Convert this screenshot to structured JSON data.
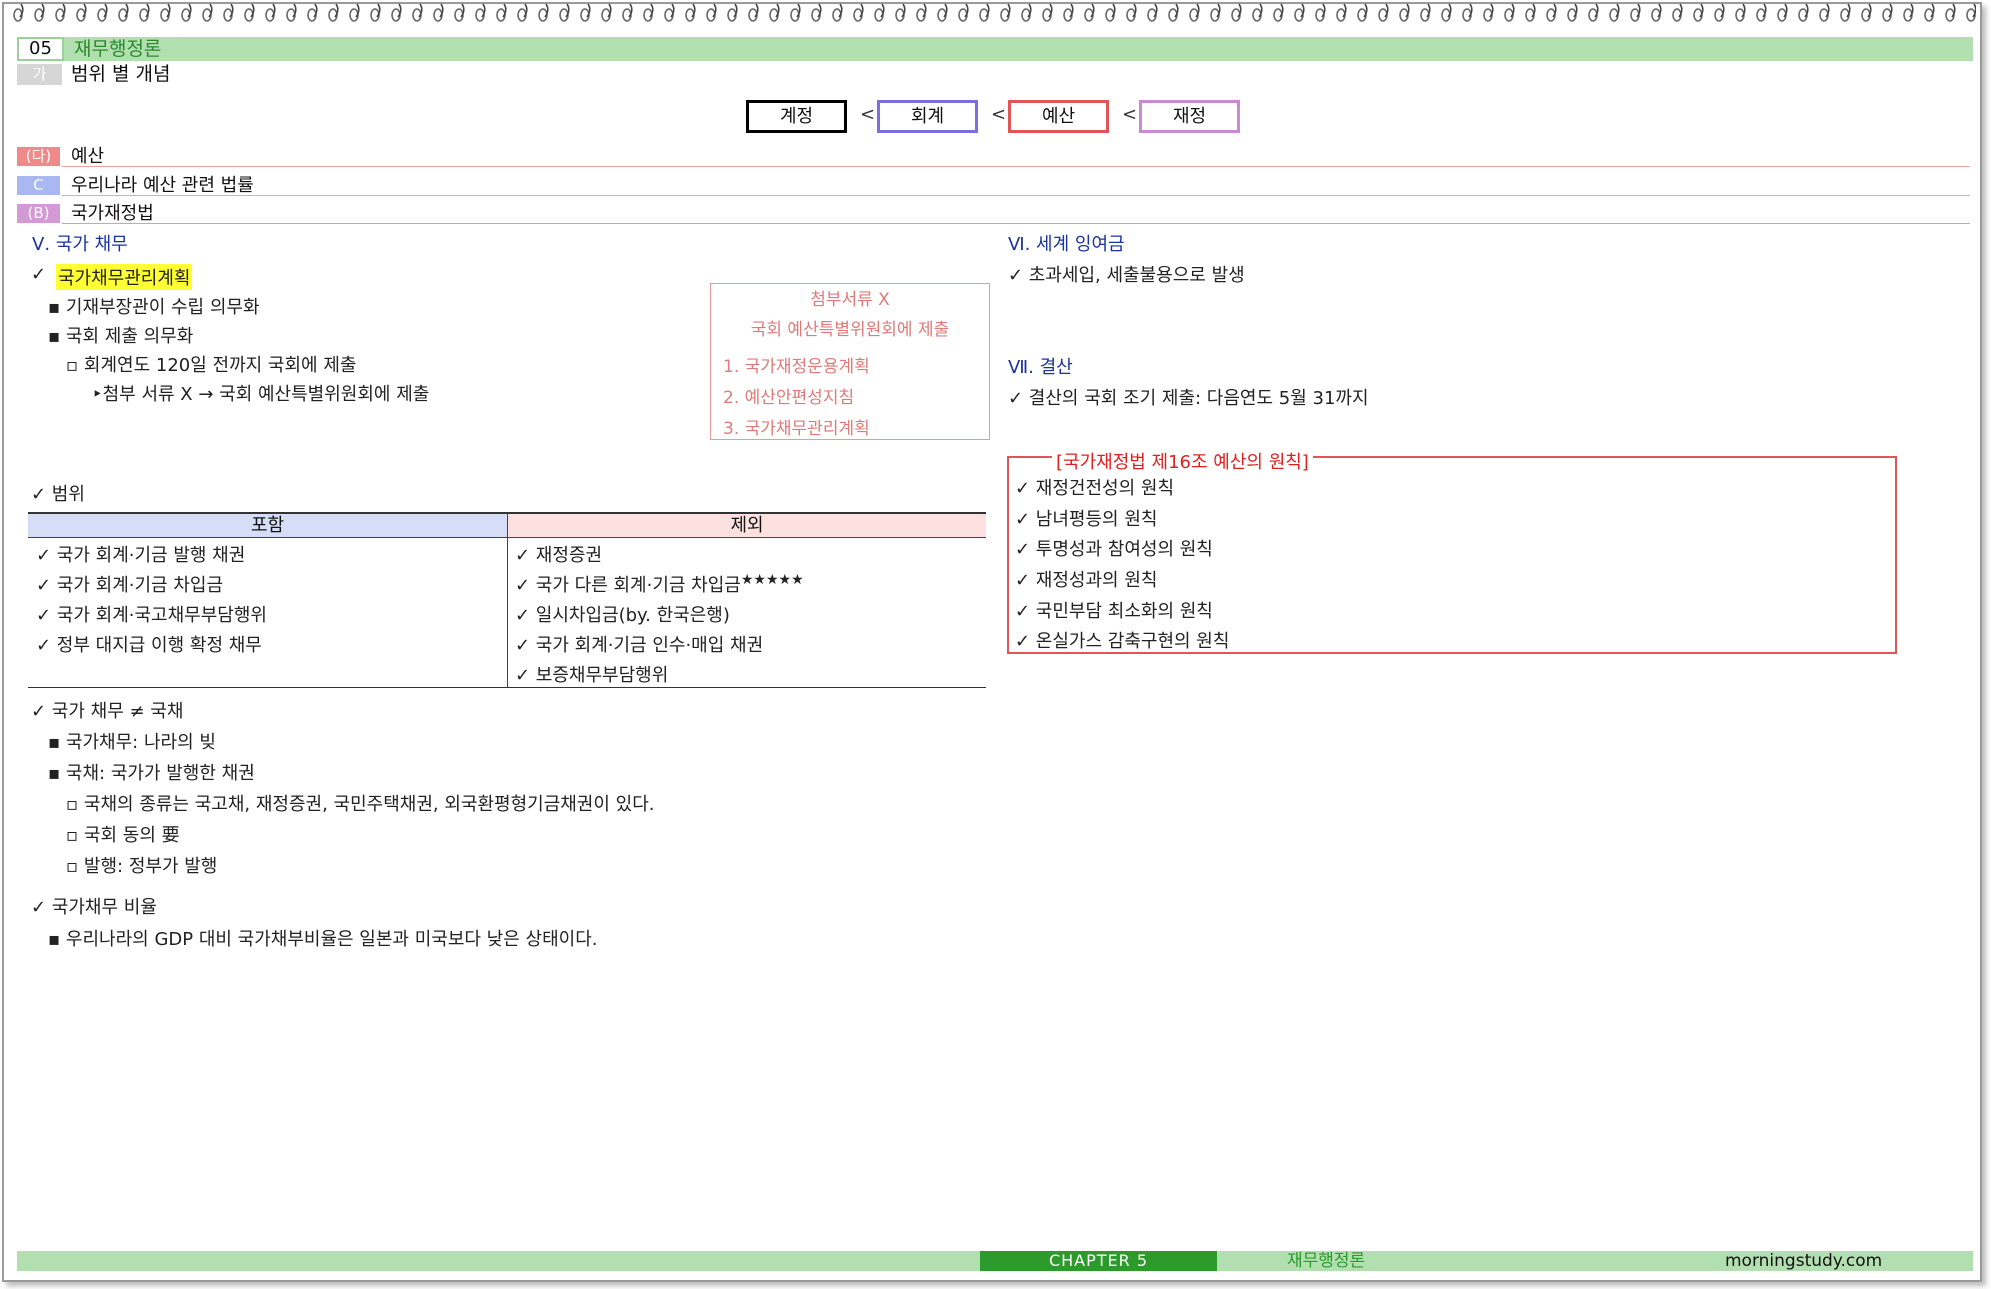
{
  "header": {
    "number": "05",
    "title": "재무행정론",
    "subtitle_tag": "가",
    "subtitle": "범위 별 개념"
  },
  "scope_chain": {
    "items": [
      "계정",
      "회계",
      "예산",
      "재정"
    ],
    "separator": "<",
    "colors": [
      "#000000",
      "#7b6fe0",
      "#e05555",
      "#c88ad0"
    ]
  },
  "sections": [
    {
      "tag": "(다)",
      "label": "예산",
      "color": "#f08a8a"
    },
    {
      "tag": "C",
      "label": "우리나라 예산 관련 법률",
      "color": "#a9b8f0"
    },
    {
      "tag": "(B)",
      "label": "국가재정법",
      "color": "#d39ad6"
    }
  ],
  "left": {
    "heading": "Ⅴ. 국가 채무",
    "plan": {
      "check_title": "✓",
      "title": "국가채무관리계획",
      "items": [
        "▪ 기재부장관이 수립 의무화",
        "▪ 국회 제출 의무화",
        "▫ 회계연도 120일 전까지 국회에 제출",
        "‣첨부 서류 X → 국회 예산특별위원회에 제출"
      ]
    },
    "attach_box": {
      "line1": "첨부서류 X",
      "line2": "국회 예산특별위원회에 제출",
      "items": [
        "1. 국가재정운용계획",
        "2. 예산안편성지침",
        "3. 국가채무관리계획"
      ]
    },
    "scope_label": "✓ 범위",
    "table": {
      "headers": [
        "포함",
        "제외"
      ],
      "include": [
        "✓ 국가 회계·기금 발행 채권",
        "✓ 국가 회계·기금 차입금",
        "✓ 국가 회계·국고채무부담행위",
        "✓ 정부 대지급 이행 확정 채무"
      ],
      "exclude": [
        "✓ 재정증권",
        "✓ 국가 다른 회계·기금 차입금",
        "✓ 일시차입금(by. 한국은행)",
        "✓ 국가 회계·기금 인수·매입 채권",
        "✓ 보증채무부담행위"
      ],
      "stars": "★★★★★"
    },
    "debt_vs_bond": {
      "title": "✓ 국가 채무 ≠ 국채",
      "items": [
        "▪ 국가채무: 나라의 빚",
        "▪ 국채: 국가가 발행한 채권",
        "▫ 국채의 종류는 국고채, 재정증권, 국민주택채권, 외국환평형기금채권이 있다.",
        "▫ 국회 동의 要",
        "▫ 발행: 정부가 발행"
      ]
    },
    "ratio": {
      "title": "✓ 국가채무 비율",
      "item": "▪ 우리나라의 GDP 대비 국가채부비율은 일본과 미국보다 낮은 상태이다."
    }
  },
  "right": {
    "surplus_heading": "Ⅵ. 세계 잉여금",
    "surplus_item": "✓ 초과세입, 세출불용으로 발생",
    "settle_heading": "Ⅶ. 결산",
    "settle_item": "✓ 결산의 국회 조기 제출: 다음연도 5월 31까지",
    "principles": {
      "title": "[국가재정법 제16조 예산의 원칙]",
      "items": [
        "✓ 재정건전성의 원칙",
        "✓ 남녀평등의 원칙",
        "✓ 투명성과 참여성의 원칙",
        "✓ 재정성과의 원칙",
        "✓ 국민부담 최소화의 원칙",
        "✓ 온실가스 감축구현의 원칙"
      ]
    }
  },
  "footer": {
    "chapter": "CHAPTER 5",
    "subject": "재무행정론",
    "site": "morningstudy.com"
  }
}
